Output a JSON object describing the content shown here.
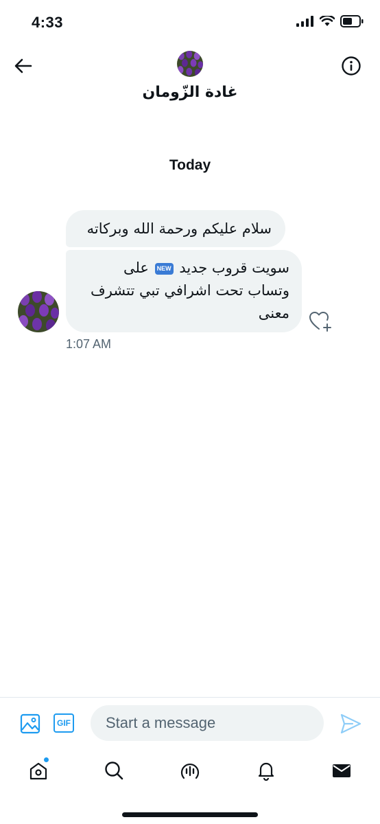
{
  "status_bar": {
    "time": "4:33",
    "icons": [
      "signal-icon",
      "wifi-icon",
      "battery-icon"
    ]
  },
  "header": {
    "name": "غادة الزّومان",
    "back_icon": "arrow-left-icon",
    "info_icon": "info-icon"
  },
  "conversation": {
    "day_label": "Today",
    "messages": [
      {
        "text": "سلام عليكم ورحمة الله وبركاته"
      },
      {
        "text_part1": "سويت قروب جديد",
        "emoji": "NEW",
        "text_part2": "على وتساب تحت اشرافي تبي تتشرف معنى"
      }
    ],
    "timestamp": "1:07 AM"
  },
  "composer": {
    "placeholder": "Start a message",
    "gif_label": "GIF"
  },
  "tab_bar": {
    "items": [
      "home-icon",
      "search-icon",
      "spaces-icon",
      "notifications-icon",
      "messages-icon"
    ]
  },
  "colors": {
    "accent": "#1d9bf0",
    "bubble": "#eff3f4",
    "text": "#0f1419",
    "secondary": "#536471"
  }
}
